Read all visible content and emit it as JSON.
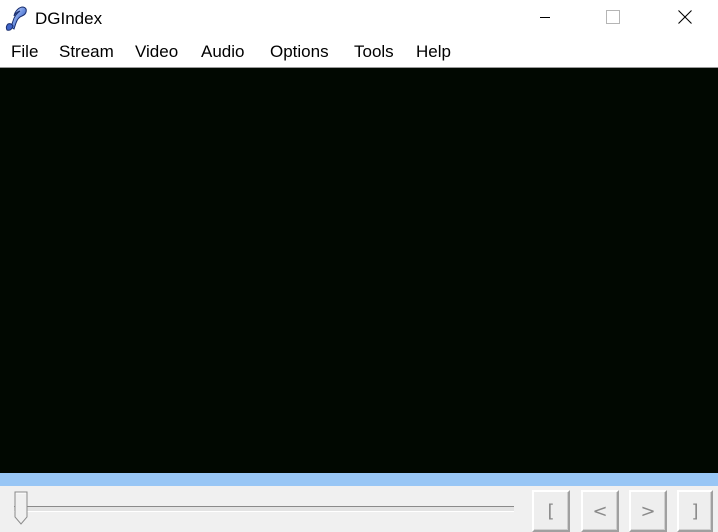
{
  "window": {
    "title": "DGIndex",
    "app_icon": "dgindex-quill-icon",
    "controls": {
      "minimize": "minimize-icon",
      "maximize": "maximize-icon",
      "close": "close-icon"
    }
  },
  "menubar": {
    "items": [
      {
        "label": "File"
      },
      {
        "label": "Stream"
      },
      {
        "label": "Video"
      },
      {
        "label": "Audio"
      },
      {
        "label": "Options"
      },
      {
        "label": "Tools"
      },
      {
        "label": "Help"
      }
    ]
  },
  "video": {
    "background_color": "#010801"
  },
  "progress": {
    "fraction": 1.0,
    "color": "#98c6f5"
  },
  "playback": {
    "slider_position": 0.0,
    "buttons": [
      {
        "label": "[",
        "role": "mark-start"
      },
      {
        "label": "<",
        "role": "step-back"
      },
      {
        "label": ">",
        "role": "step-forward"
      },
      {
        "label": "]",
        "role": "mark-end"
      }
    ]
  }
}
